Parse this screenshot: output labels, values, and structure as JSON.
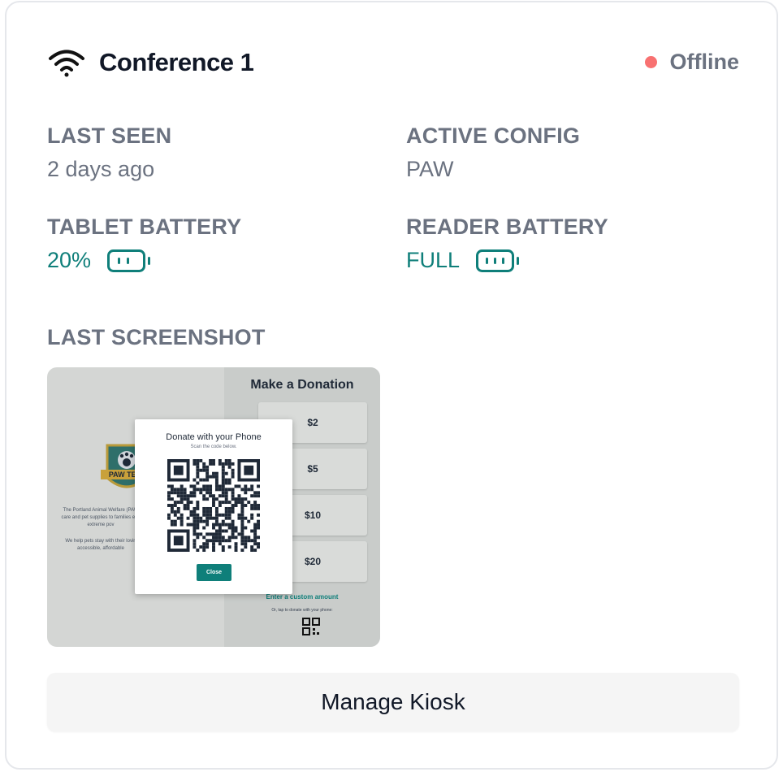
{
  "kiosk": {
    "name": "Conference 1",
    "status": "Offline",
    "status_color": "#f87171",
    "wifi_icon": "wifi-icon"
  },
  "fields": {
    "last_seen_label": "LAST SEEN",
    "last_seen_value": "2 days ago",
    "active_config_label": "ACTIVE CONFIG",
    "active_config_value": "PAW",
    "tablet_battery_label": "TABLET BATTERY",
    "tablet_battery_value": "20%",
    "reader_battery_label": "READER BATTERY",
    "reader_battery_value": "FULL",
    "last_screenshot_label": "LAST SCREENSHOT"
  },
  "screenshot": {
    "heading": "Make a Donation",
    "amounts": [
      "$2",
      "$5",
      "$10",
      "$20"
    ],
    "custom_amount": "Enter a custom amount",
    "tap_note": "Or, tap to donate with your phone:",
    "badge_text": "PAW TEA",
    "description_lines": [
      "The Portland Animal Welfare (PAW",
      "care and pet supplies to families exp",
      "extreme pov",
      "",
      "We help pets stay with their lovin",
      "accessible, affordable"
    ],
    "modal": {
      "title": "Donate with your Phone",
      "subtitle": "Scan the code below.",
      "close": "Close"
    }
  },
  "actions": {
    "manage": "Manage Kiosk"
  },
  "colors": {
    "accent": "#0f7f7a",
    "muted": "#6b7280",
    "text": "#111827"
  }
}
